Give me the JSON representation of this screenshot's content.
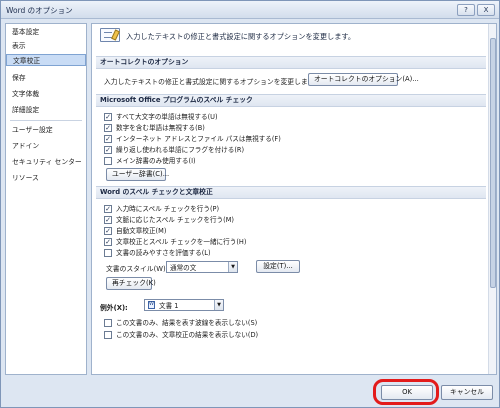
{
  "window": {
    "title": "Word のオプション",
    "help": "?",
    "close": "X"
  },
  "sidebar": {
    "items": [
      {
        "label": "基本設定"
      },
      {
        "label": "表示"
      },
      {
        "label": "文章校正",
        "selected": true
      },
      {
        "label": "保存"
      },
      {
        "label": "文字体裁"
      },
      {
        "label": "詳細設定"
      },
      {
        "label": "ユーザー設定"
      },
      {
        "label": "アドイン"
      },
      {
        "label": "セキュリティ センター"
      },
      {
        "label": "リソース"
      }
    ]
  },
  "header": {
    "icon": "proofing-icon",
    "description": "入力したテキストの修正と書式設定に関するオプションを変更します。"
  },
  "autocorrect": {
    "title": "オートコレクトのオプション",
    "description": "入力したテキストの修正と書式設定に関するオプションを変更します:",
    "button_label": "オートコレクトのオプション(A)..."
  },
  "office_spell": {
    "title": "Microsoft Office プログラムのスペル チェック",
    "options": [
      {
        "label": "すべて大文字の単語は無視する(U)",
        "checked": true
      },
      {
        "label": "数字を含む単語は無視する(B)",
        "checked": true
      },
      {
        "label": "インターネット アドレスとファイル パスは無視する(F)",
        "checked": true
      },
      {
        "label": "繰り返し使われる単語にフラグを付ける(R)",
        "checked": true
      },
      {
        "label": "メイン辞書のみ使用する(I)",
        "checked": false
      }
    ],
    "user_dict_button": "ユーザー辞書(C)..."
  },
  "word_spell": {
    "title": "Word のスペル チェックと文章校正",
    "options": [
      {
        "label": "入力時にスペル チェックを行う(P)",
        "checked": true
      },
      {
        "label": "文脈に応じたスペル チェックを行う(M)",
        "checked": true
      },
      {
        "label": "自動文章校正(M)",
        "checked": true
      },
      {
        "label": "文章校正とスペル チェックを一緒に行う(H)",
        "checked": true
      },
      {
        "label": "文書の読みやすさを評価する(L)",
        "checked": false
      }
    ],
    "style_label": "文書のスタイル(W):",
    "style_value": "通常の文",
    "settings_button": "設定(T)...",
    "recheck_button": "再チェック(K)"
  },
  "exceptions": {
    "label": "例外(X):",
    "doc_value": "文書 1",
    "options": [
      {
        "label": "この文書のみ、結果を表す波線を表示しない(S)",
        "checked": false
      },
      {
        "label": "この文書のみ、文章校正の結果を表示しない(D)",
        "checked": false
      }
    ]
  },
  "footer": {
    "ok_label": "OK",
    "cancel_label": "キャンセル"
  },
  "colors": {
    "highlight": "#e31b1b",
    "selected_bg": "#c9dcf5"
  }
}
